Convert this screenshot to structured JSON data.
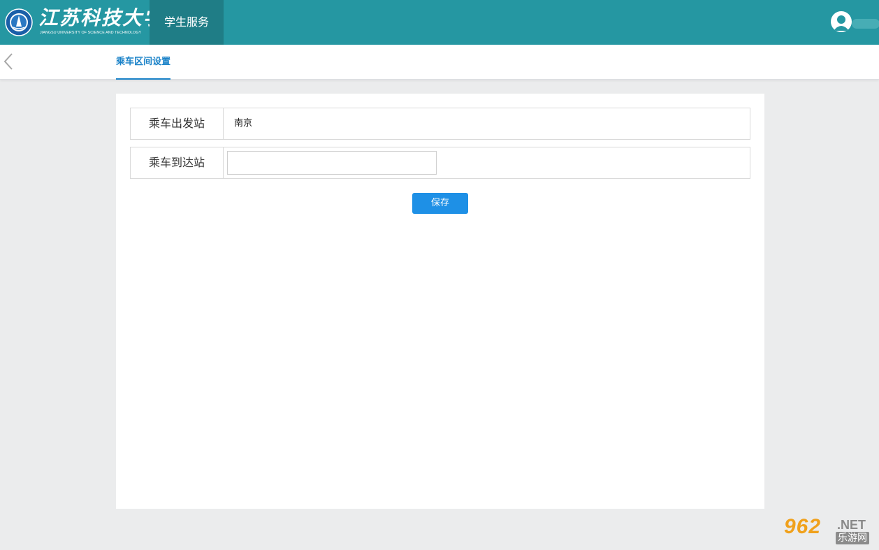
{
  "header": {
    "logo_text_cn": "江苏科技大学",
    "logo_text_en": "JIANGSU UNIVERSITY OF SCIENCE AND TECHNOLOGY",
    "nav_item": "学生服务",
    "brand_color": "#2597a2",
    "nav_active_color": "#1f7d86",
    "user_icon": "user-avatar-icon"
  },
  "subheader": {
    "back_icon": "chevron-left-icon",
    "active_tab": "乘车区间设置"
  },
  "form": {
    "rows": [
      {
        "label": "乘车出发站",
        "value": "南京"
      },
      {
        "label": "乘车到达站",
        "value": "",
        "placeholder": ""
      }
    ],
    "save_label": "保存",
    "save_color": "#1e90e6"
  },
  "watermark": {
    "number": "962",
    "domain": ".NET",
    "name_cn": "乐游网"
  }
}
